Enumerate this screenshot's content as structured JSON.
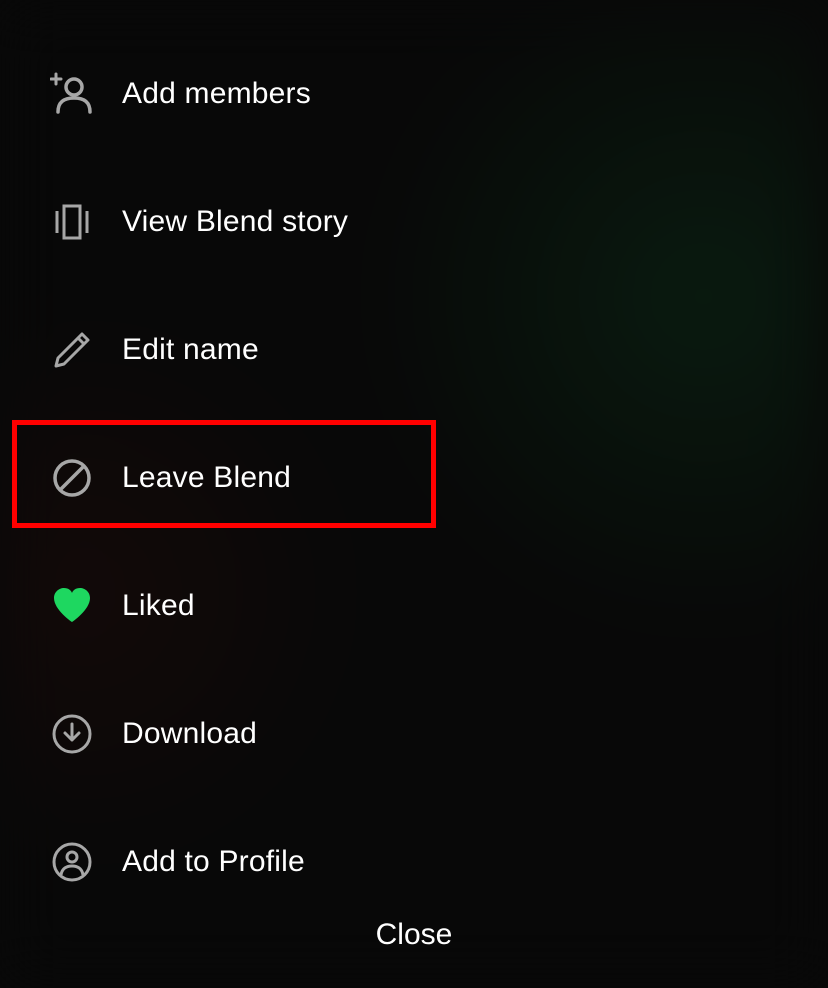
{
  "menu": {
    "items": [
      {
        "label": "Add members",
        "icon": "add-person-icon"
      },
      {
        "label": "View Blend story",
        "icon": "story-icon"
      },
      {
        "label": "Edit name",
        "icon": "pencil-icon"
      },
      {
        "label": "Leave Blend",
        "icon": "block-icon",
        "highlighted": true
      },
      {
        "label": "Liked",
        "icon": "heart-icon",
        "liked": true
      },
      {
        "label": "Download",
        "icon": "download-icon"
      },
      {
        "label": "Add to Profile",
        "icon": "profile-icon"
      }
    ]
  },
  "footer": {
    "close_label": "Close"
  },
  "colors": {
    "accent_green": "#1ed760",
    "icon_gray": "#a7a7a7",
    "highlight_red": "#ff0000"
  }
}
